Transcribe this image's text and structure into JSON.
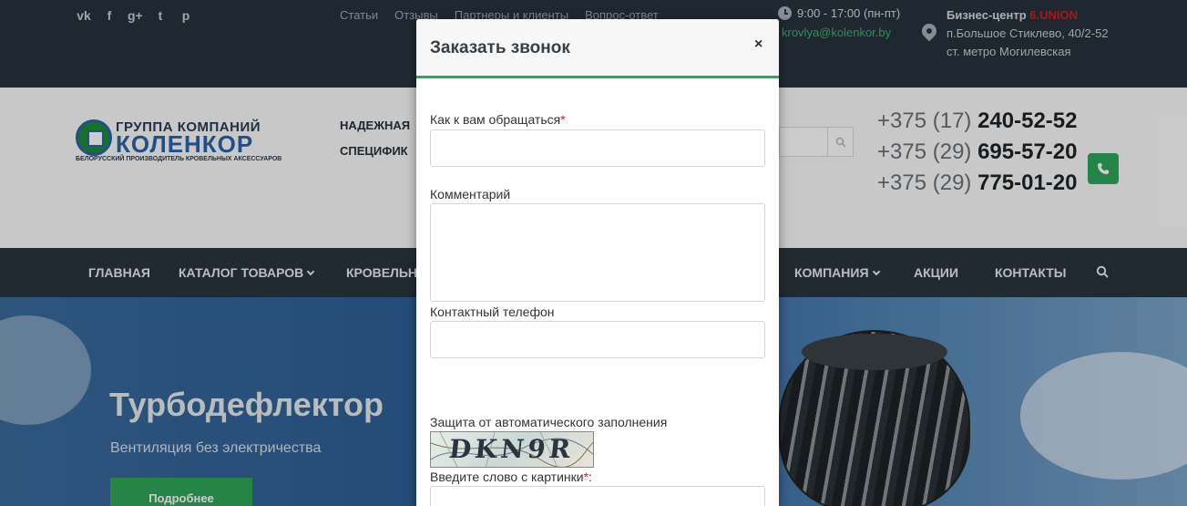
{
  "topbar": {
    "social": [
      "vk-icon",
      "facebook-icon",
      "googleplus-icon",
      "twitter-icon",
      "pinterest-icon"
    ],
    "social_glyphs": [
      "vk",
      "f",
      "g+",
      "t",
      "p"
    ],
    "links": [
      "Статьи",
      "Отзывы",
      "Партнеры и клиенты",
      "Вопрос-ответ"
    ],
    "hours": "9:00 - 17:00 (пн-пт)",
    "email": "krovlya@kolenkor.by",
    "address_prefix": "Бизнес-центр",
    "address_union": "6.UNION",
    "address_line2": "п.Большое Стиклево, 40/2-52",
    "address_line3": "ст. метро Могилевская"
  },
  "header": {
    "logo_line1": "ГРУППА КОМПАНИЙ",
    "logo_line2": "КОЛЕНКОР",
    "logo_line3": "БЕЛОРУССКИЙ ПРОИЗВОДИТЕЛЬ КРОВЕЛЬНЫХ АКСЕССУАРОВ",
    "slogan_line1": "НАДЕЖНАЯ",
    "slogan_line2": "СПЕЦИФИК",
    "phones": [
      {
        "code": "+375 (17) ",
        "number": "240-52-52"
      },
      {
        "code": "+375 (29) ",
        "number": "695-57-20"
      },
      {
        "code": "+375 (29) ",
        "number": "775-01-20"
      }
    ]
  },
  "nav": {
    "items": [
      "ГЛАВНАЯ",
      "КАТАЛОГ ТОВАРОВ",
      "КРОВЕЛЬН",
      "КОМПАНИЯ",
      "АКЦИИ",
      "КОНТАКТЫ"
    ]
  },
  "hero": {
    "title": "Турбодефлектор",
    "subtitle": "Вентиляция без электричества",
    "button": "Подробнее"
  },
  "modal": {
    "title": "Заказать звонок",
    "close": "×",
    "name_label": "Как к вам обращаться",
    "comment_label": "Комментарий",
    "phone_label": "Контактный телефон",
    "captcha_label": "Защита от автоматического заполнения",
    "captcha_text": "DKN9R",
    "captcha_input_label": "Введите слово с картинки",
    "required_mark": "*",
    "colon": ":"
  },
  "colors": {
    "accent_green": "#2fa75a",
    "topbar_bg": "#27323d",
    "nav_bg": "#2a343e",
    "required_red": "#d01f26"
  }
}
